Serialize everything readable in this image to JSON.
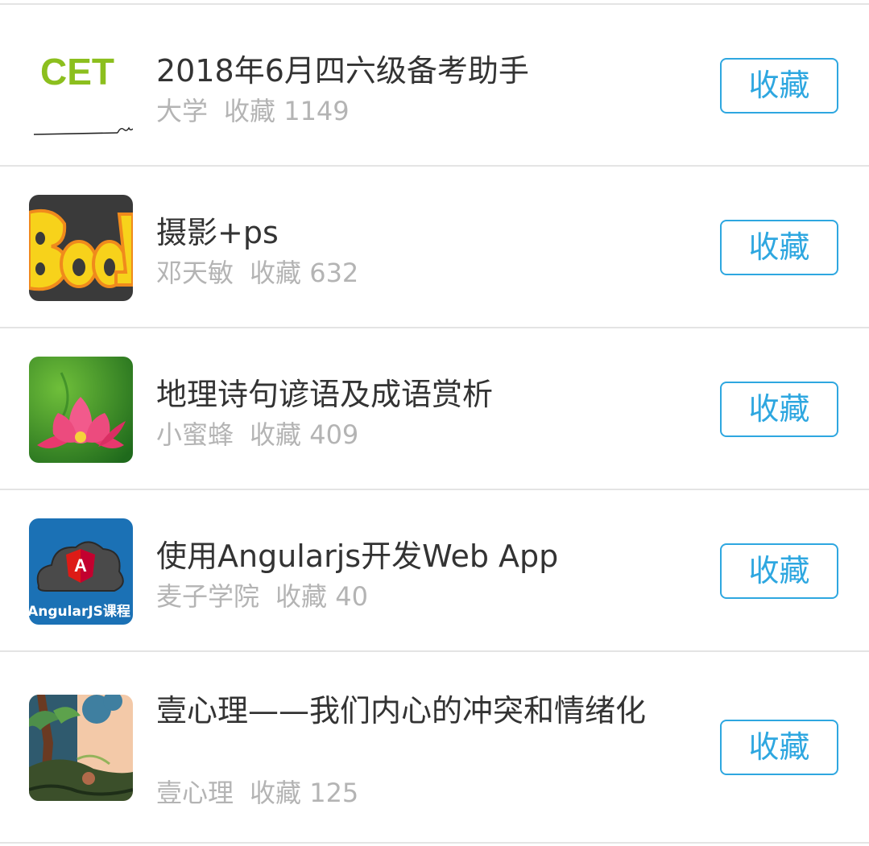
{
  "button_label": "收藏",
  "favorites_label": "收藏",
  "items": [
    {
      "title": "2018年6月四六级备考助手",
      "author": "大学",
      "count": "1149",
      "thumb_text": "CET"
    },
    {
      "title": "摄影+ps",
      "author": "邓天敏",
      "count": "632"
    },
    {
      "title": "地理诗句谚语及成语赏析",
      "author": "小蜜蜂",
      "count": "409"
    },
    {
      "title": "使用Angularjs开发Web App",
      "author": "麦子学院",
      "count": "40",
      "thumb_text": "AngularJS课程",
      "thumb_glyph": "A"
    },
    {
      "title": "壹心理——我们内心的冲突和情绪化",
      "author": "壹心理",
      "count": "125"
    }
  ],
  "colors": {
    "accent": "#2ea7e0",
    "title": "#333333",
    "meta": "#b4b4b4",
    "divider": "#e4e4e4"
  }
}
